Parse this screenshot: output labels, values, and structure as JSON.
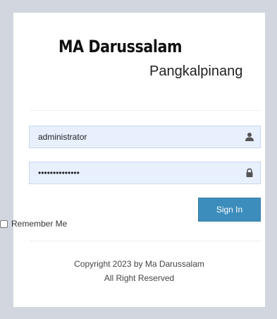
{
  "brand": {
    "title": "MA Darussalam",
    "subtitle": "Pangkalpinang"
  },
  "form": {
    "username_value": "administrator",
    "password_value": "••••••••••••••",
    "username_icon": "user-icon",
    "password_icon": "lock-icon",
    "remember_label": "Remember Me",
    "remember_checked": false,
    "submit_label": "Sign In"
  },
  "footer": {
    "copyright_line1": "Copyright 2023 by Ma Darussalam",
    "copyright_line2": "All Right Reserved"
  },
  "colors": {
    "page_bg": "#d2d6de",
    "card_bg": "#ffffff",
    "input_bg": "#e8f0fe",
    "button_bg": "#3c8dbc"
  }
}
